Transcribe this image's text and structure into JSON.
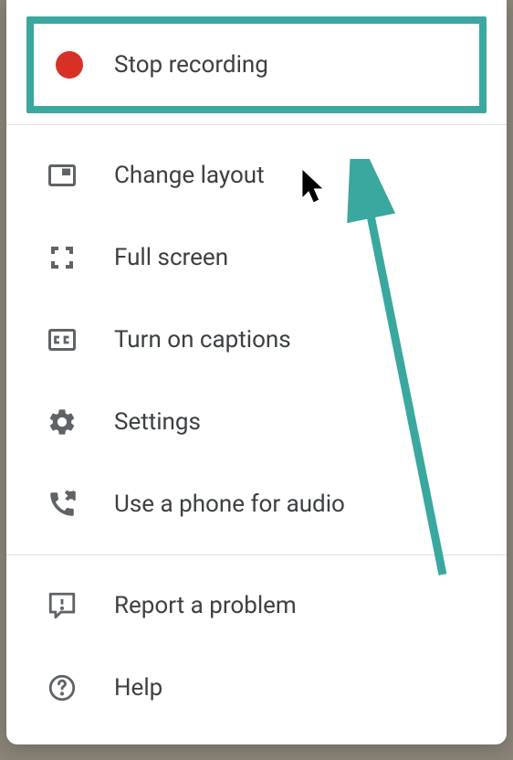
{
  "menu": {
    "stopRecording": {
      "label": "Stop recording"
    },
    "changeLayout": {
      "label": "Change layout"
    },
    "fullScreen": {
      "label": "Full screen"
    },
    "captions": {
      "label": "Turn on captions"
    },
    "settings": {
      "label": "Settings"
    },
    "phoneAudio": {
      "label": "Use a phone for audio"
    },
    "reportProblem": {
      "label": "Report a problem"
    },
    "help": {
      "label": "Help"
    }
  },
  "colors": {
    "highlight": "#3aa89e",
    "recordDot": "#d93025",
    "iconGray": "#5f6368",
    "textGray": "#3c4043"
  }
}
